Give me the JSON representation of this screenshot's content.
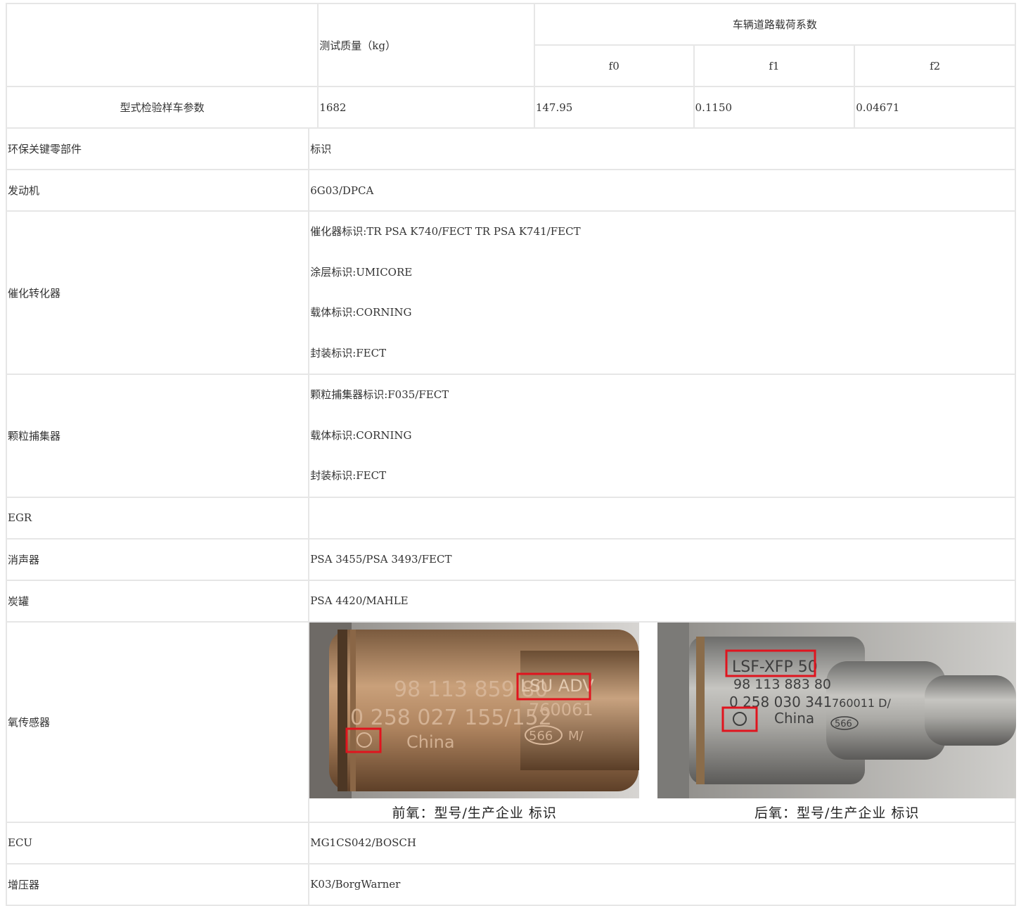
{
  "load_table": {
    "mass_header": "测试质量（kg）",
    "coef_header": "车辆道路载荷系数",
    "f0_header": "f0",
    "f1_header": "f1",
    "f2_header": "f2",
    "row_label": "型式检验样车参数",
    "mass": "1682",
    "f0": "147.95",
    "f1": "0.1150",
    "f2": "0.04671"
  },
  "parts": {
    "header_part": "环保关键零部件",
    "header_mark": "标识",
    "engine_label": "发动机",
    "engine_value": "6G03/DPCA",
    "catalyst_label": "催化转化器",
    "catalyst_lines": [
      "催化器标识:TR PSA K740/FECT TR PSA K741/FECT",
      "涂层标识:UMICORE",
      "载体标识:CORNING",
      "封装标识:FECT"
    ],
    "gpf_label": "颗粒捕集器",
    "gpf_lines": [
      "颗粒捕集器标识:F035/FECT",
      "载体标识:CORNING",
      "封装标识:FECT"
    ],
    "egr_label": "EGR",
    "egr_value": "",
    "muffler_label": "消声器",
    "muffler_value": "PSA 3455/PSA 3493/FECT",
    "canister_label": "炭罐",
    "canister_value": "PSA 4420/MAHLE",
    "o2_label": "氧传感器",
    "o2_front": {
      "caption": "前氧：型号/生产企业 标识",
      "part_no": "98 113 859 80",
      "bosch_no": "0 258 027 155/152",
      "model": "LSU ADV",
      "code": "760061",
      "origin": "China",
      "plant": "566",
      "suffix": "M/"
    },
    "o2_rear": {
      "caption": "后氧：型号/生产企业 标识",
      "model": "LSF-XFP 50",
      "part_no": "98 113 883 80",
      "bosch_no": "0 258 030 341",
      "code": "760011 D/",
      "origin": "China",
      "plant": "566"
    },
    "ecu_label": "ECU",
    "ecu_value": "MG1CS042/BOSCH",
    "turbo_label": "增压器",
    "turbo_value": "K03/BorgWarner"
  },
  "colors": {
    "border": "#e6e6e6",
    "highlight": "#e0141e",
    "text": "#333333"
  }
}
